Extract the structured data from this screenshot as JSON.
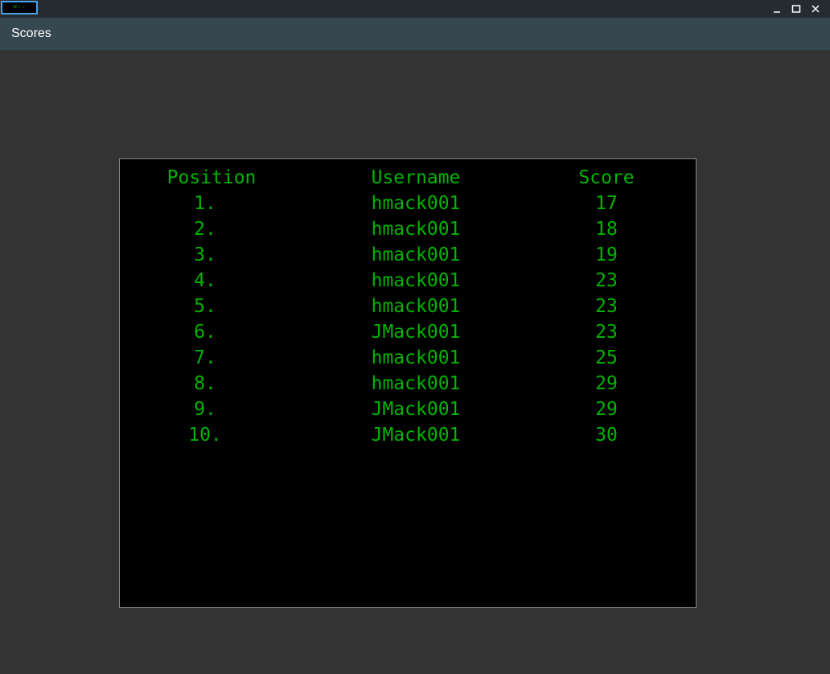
{
  "titlebar": {
    "back_label": "<--",
    "controls": [
      "minimize-icon",
      "maximize-icon",
      "close-icon"
    ]
  },
  "app": {
    "title": "Scores"
  },
  "table": {
    "headers": {
      "position": "Position",
      "username": "Username",
      "score": "Score"
    },
    "rows": [
      {
        "position": "1.",
        "username": "hmack001",
        "score": "17"
      },
      {
        "position": "2.",
        "username": "hmack001",
        "score": "18"
      },
      {
        "position": "3.",
        "username": "hmack001",
        "score": "19"
      },
      {
        "position": "4.",
        "username": "hmack001",
        "score": "23"
      },
      {
        "position": "5.",
        "username": "hmack001",
        "score": "23"
      },
      {
        "position": "6.",
        "username": "JMack001",
        "score": "23"
      },
      {
        "position": "7.",
        "username": "hmack001",
        "score": "25"
      },
      {
        "position": "8.",
        "username": "hmack001",
        "score": "29"
      },
      {
        "position": "9.",
        "username": "JMack001",
        "score": "29"
      },
      {
        "position": "10.",
        "username": "JMack001",
        "score": "30"
      }
    ]
  },
  "colors": {
    "text_green": "#00b400",
    "panel_bg": "#000000",
    "window_bg": "#333333",
    "appbar_bg": "#37474f",
    "titlebar_bg": "#252c31",
    "focus_accent": "#4aa3f0"
  }
}
